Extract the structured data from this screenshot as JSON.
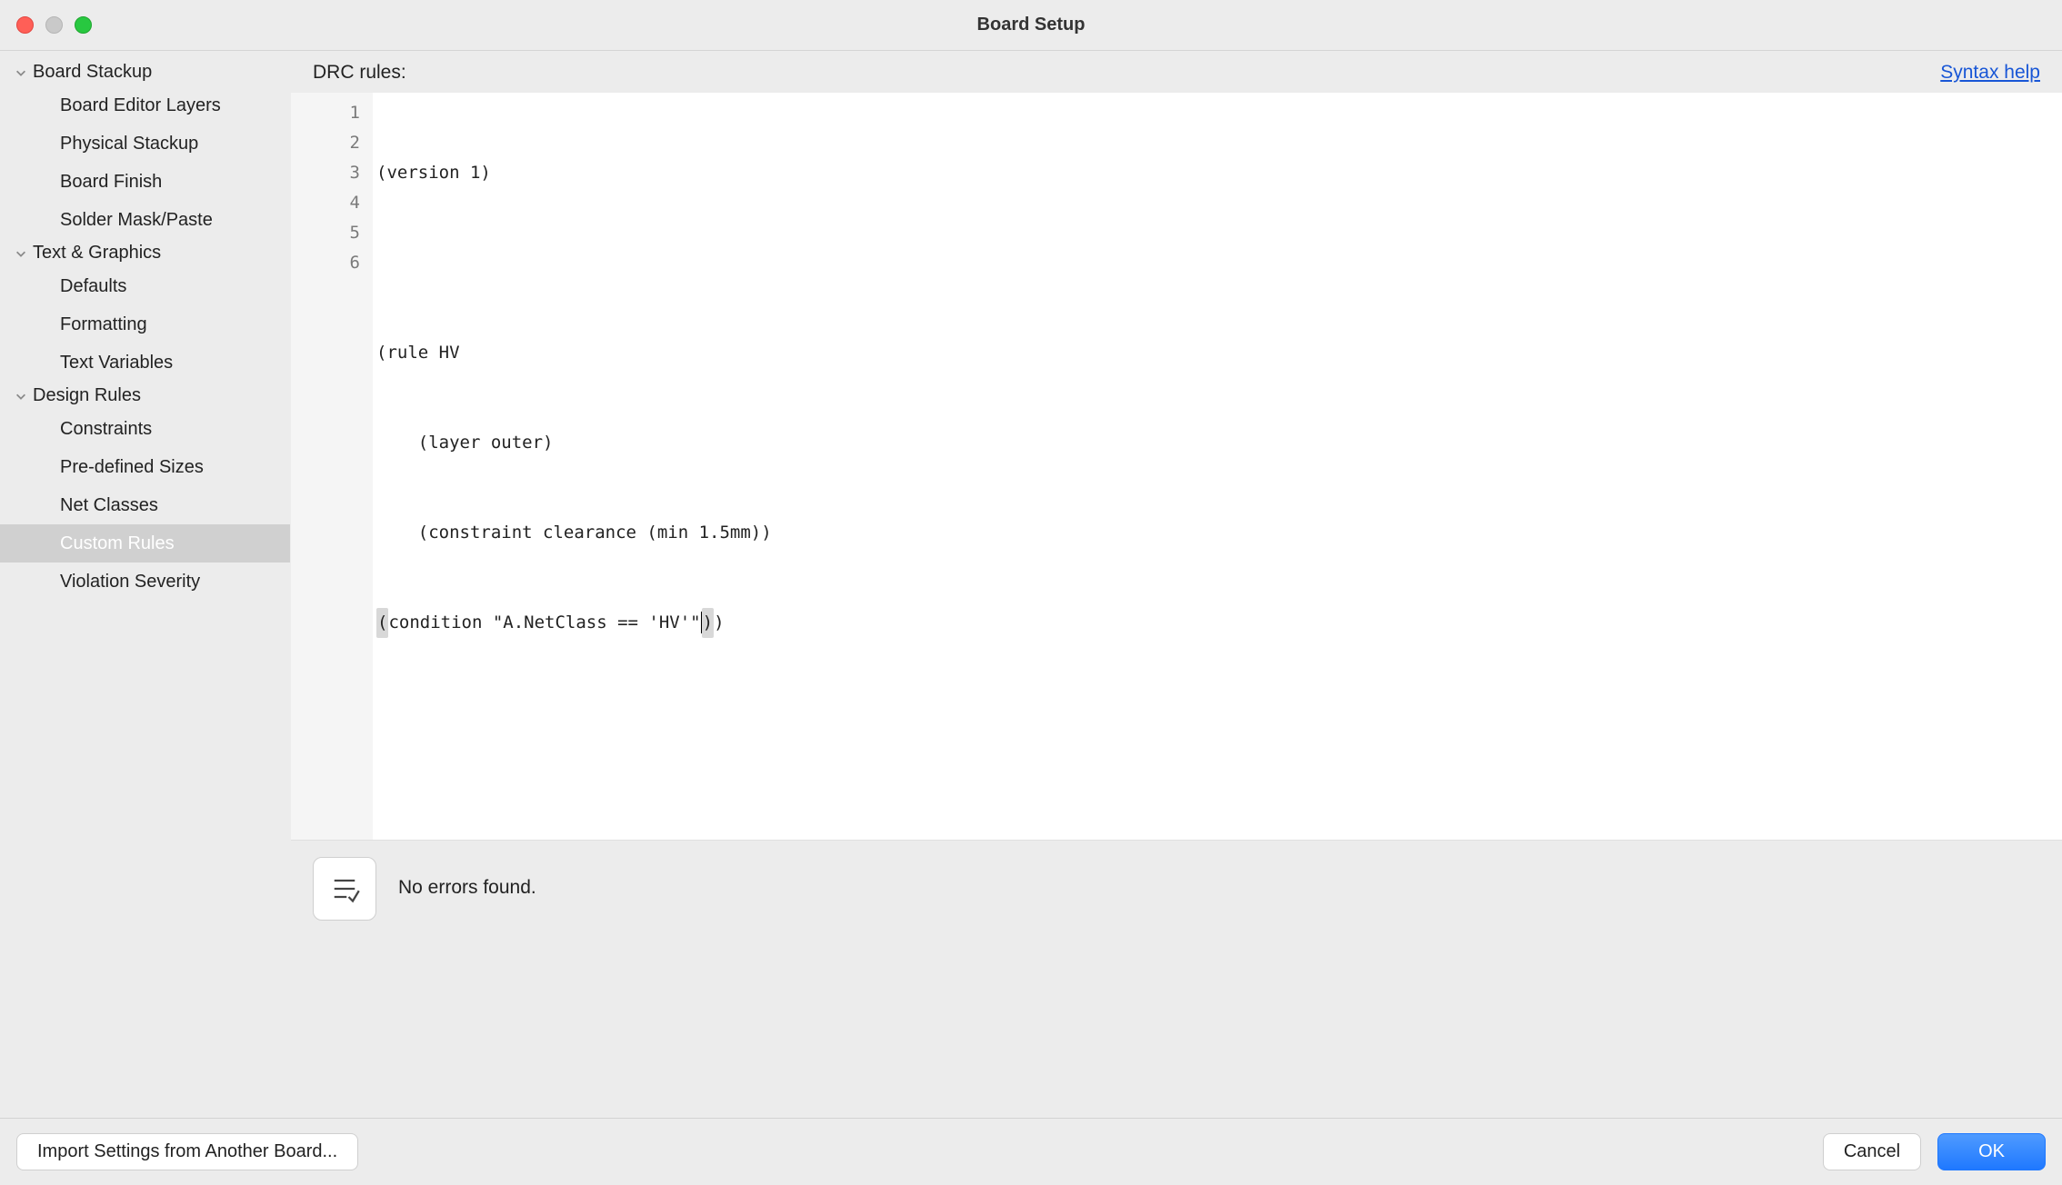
{
  "window": {
    "title": "Board Setup"
  },
  "sidebar": {
    "groups": [
      {
        "label": "Board Stackup",
        "items": [
          "Board Editor Layers",
          "Physical Stackup",
          "Board Finish",
          "Solder Mask/Paste"
        ]
      },
      {
        "label": "Text & Graphics",
        "items": [
          "Defaults",
          "Formatting",
          "Text Variables"
        ]
      },
      {
        "label": "Design Rules",
        "items": [
          "Constraints",
          "Pre-defined Sizes",
          "Net Classes",
          "Custom Rules",
          "Violation Severity"
        ]
      }
    ],
    "selected": "Custom Rules"
  },
  "header": {
    "label": "DRC rules:",
    "syntax_link": "Syntax help"
  },
  "code": {
    "lines": [
      "(version 1)",
      "",
      "(rule HV",
      "    (layer outer)",
      "    (constraint clearance (min 1.5mm))",
      "    (condition \"A.NetClass == 'HV'\"))"
    ]
  },
  "status": {
    "text": "No errors found."
  },
  "footer": {
    "import": "Import Settings from Another Board...",
    "cancel": "Cancel",
    "ok": "OK"
  }
}
